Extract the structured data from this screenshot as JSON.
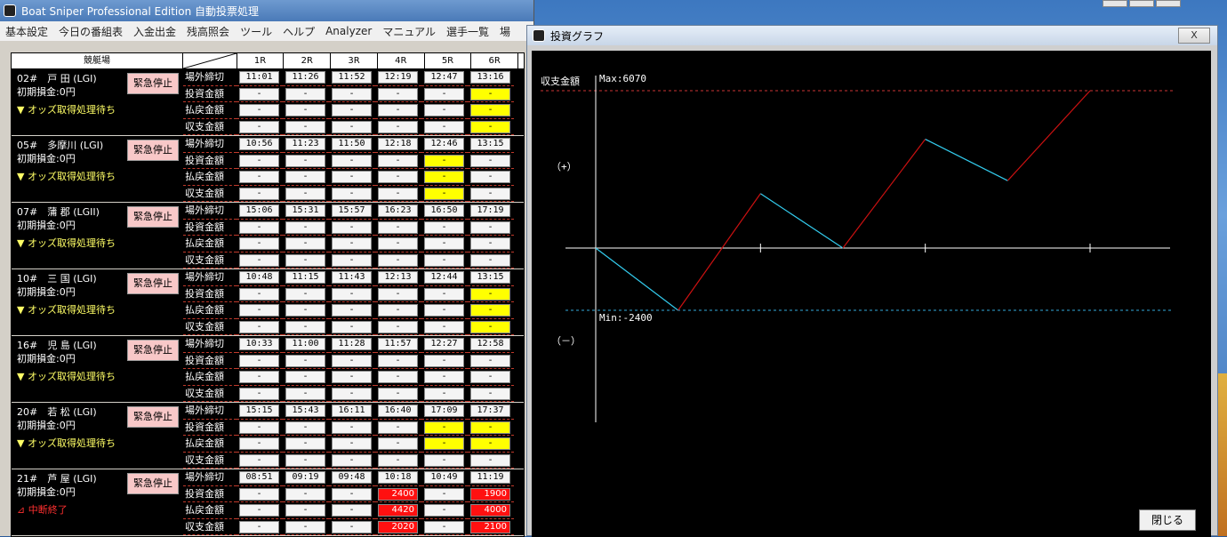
{
  "main_window": {
    "title": "Boat Sniper Professional Edition 自動投票処理"
  },
  "menu": [
    "基本設定",
    "今日の番組表",
    "入金出金",
    "残高照会",
    "ツール",
    "ヘルプ",
    "Analyzer",
    "マニュアル",
    "選手一覧",
    "場"
  ],
  "grid": {
    "header_venue": "競艇場",
    "races": [
      "1R",
      "2R",
      "3R",
      "4R",
      "5R",
      "6R"
    ],
    "row_labels": [
      "場外締切",
      "投資金額",
      "払戻金額",
      "収支金額"
    ],
    "stop_label": "緊急停止",
    "venues": [
      {
        "name": "02#　戸 田 (LGI)",
        "fund": "初期損金:0円",
        "status": "▼ オッズ取得処理待ち",
        "status_color": "yellow",
        "times": [
          "11:01",
          "11:26",
          "11:52",
          "12:19",
          "12:47",
          "13:16"
        ],
        "invest": [
          "-",
          "-",
          "-",
          "-",
          "-",
          "-"
        ],
        "refund": [
          "-",
          "-",
          "-",
          "-",
          "-",
          "-"
        ],
        "balance": [
          "-",
          "-",
          "-",
          "-",
          "-",
          "-"
        ],
        "invest_hl": [
          "",
          "",
          "",
          "",
          "",
          "y"
        ],
        "refund_hl": [
          "",
          "",
          "",
          "",
          "",
          "y"
        ],
        "balance_hl": [
          "",
          "",
          "",
          "",
          "",
          "y"
        ]
      },
      {
        "name": "05#　多摩川 (LGI)",
        "fund": "初期損金:0円",
        "status": "▼ オッズ取得処理待ち",
        "status_color": "yellow",
        "times": [
          "10:56",
          "11:23",
          "11:50",
          "12:18",
          "12:46",
          "13:15"
        ],
        "invest": [
          "-",
          "-",
          "-",
          "-",
          "-",
          "-"
        ],
        "refund": [
          "-",
          "-",
          "-",
          "-",
          "-",
          "-"
        ],
        "balance": [
          "-",
          "-",
          "-",
          "-",
          "-",
          "-"
        ],
        "invest_hl": [
          "",
          "",
          "",
          "",
          "y",
          ""
        ],
        "refund_hl": [
          "",
          "",
          "",
          "",
          "y",
          ""
        ],
        "balance_hl": [
          "",
          "",
          "",
          "",
          "y",
          ""
        ]
      },
      {
        "name": "07#　蒲 郡 (LGII)",
        "fund": "初期損金:0円",
        "status": "▼ オッズ取得処理待ち",
        "status_color": "yellow",
        "times": [
          "15:06",
          "15:31",
          "15:57",
          "16:23",
          "16:50",
          "17:19"
        ],
        "invest": [
          "-",
          "-",
          "-",
          "-",
          "-",
          "-"
        ],
        "refund": [
          "-",
          "-",
          "-",
          "-",
          "-",
          "-"
        ],
        "balance": [
          "-",
          "-",
          "-",
          "-",
          "-",
          "-"
        ],
        "invest_hl": [
          "",
          "",
          "",
          "",
          "",
          ""
        ],
        "refund_hl": [
          "",
          "",
          "",
          "",
          "",
          ""
        ],
        "balance_hl": [
          "",
          "",
          "",
          "",
          "",
          ""
        ]
      },
      {
        "name": "10#　三 国 (LGI)",
        "fund": "初期損金:0円",
        "status": "▼ オッズ取得処理待ち",
        "status_color": "yellow",
        "times": [
          "10:48",
          "11:15",
          "11:43",
          "12:13",
          "12:44",
          "13:15"
        ],
        "invest": [
          "-",
          "-",
          "-",
          "-",
          "-",
          "-"
        ],
        "refund": [
          "-",
          "-",
          "-",
          "-",
          "-",
          "-"
        ],
        "balance": [
          "-",
          "-",
          "-",
          "-",
          "-",
          "-"
        ],
        "invest_hl": [
          "",
          "",
          "",
          "",
          "",
          "y"
        ],
        "refund_hl": [
          "",
          "",
          "",
          "",
          "",
          "y"
        ],
        "balance_hl": [
          "",
          "",
          "",
          "",
          "",
          "y"
        ]
      },
      {
        "name": "16#　児 島 (LGI)",
        "fund": "初期損金:0円",
        "status": "▼ オッズ取得処理待ち",
        "status_color": "yellow",
        "times": [
          "10:33",
          "11:00",
          "11:28",
          "11:57",
          "12:27",
          "12:58"
        ],
        "invest": [
          "-",
          "-",
          "-",
          "-",
          "-",
          "-"
        ],
        "refund": [
          "-",
          "-",
          "-",
          "-",
          "-",
          "-"
        ],
        "balance": [
          "-",
          "-",
          "-",
          "-",
          "-",
          "-"
        ],
        "invest_hl": [
          "",
          "",
          "",
          "",
          "",
          ""
        ],
        "refund_hl": [
          "",
          "",
          "",
          "",
          "",
          ""
        ],
        "balance_hl": [
          "",
          "",
          "",
          "",
          "",
          ""
        ]
      },
      {
        "name": "20#　若 松 (LGI)",
        "fund": "初期損金:0円",
        "status": "▼ オッズ取得処理待ち",
        "status_color": "yellow",
        "times": [
          "15:15",
          "15:43",
          "16:11",
          "16:40",
          "17:09",
          "17:37"
        ],
        "invest": [
          "-",
          "-",
          "-",
          "-",
          "-",
          "-"
        ],
        "refund": [
          "-",
          "-",
          "-",
          "-",
          "-",
          "-"
        ],
        "balance": [
          "-",
          "-",
          "-",
          "-",
          "-",
          "-"
        ],
        "invest_hl": [
          "",
          "",
          "",
          "",
          "y",
          "y"
        ],
        "refund_hl": [
          "",
          "",
          "",
          "",
          "y",
          "y"
        ],
        "balance_hl": [
          "",
          "",
          "",
          "",
          "",
          ""
        ]
      },
      {
        "name": "21#　芦 屋 (LGI)",
        "fund": "初期損金:0円",
        "status": "⊿ 中断終了",
        "status_color": "red",
        "times": [
          "08:51",
          "09:19",
          "09:48",
          "10:18",
          "10:49",
          "11:19"
        ],
        "invest": [
          "-",
          "-",
          "-",
          "2400",
          "-",
          "1900"
        ],
        "refund": [
          "-",
          "-",
          "-",
          "4420",
          "-",
          "4000"
        ],
        "balance": [
          "-",
          "-",
          "-",
          "2020",
          "-",
          "2100"
        ],
        "invest_hl": [
          "",
          "",
          "",
          "r",
          "",
          "r"
        ],
        "refund_hl": [
          "",
          "",
          "",
          "r",
          "",
          "r"
        ],
        "balance_hl": [
          "",
          "",
          "",
          "r",
          "",
          "r"
        ]
      }
    ]
  },
  "graph_window": {
    "title": "投資グラフ",
    "close_x": "X",
    "close_button": "閉じる",
    "colors": {
      "gain": "#cc1111",
      "loss": "#33ccee",
      "axis": "#ffffff",
      "max_line": "#cc3333",
      "min_line": "#33aadd"
    },
    "labels": {
      "ylabel": "収支金額",
      "plus": "（+）",
      "minus": "（－）",
      "max_label": "Max:6070",
      "min_label": "Min:-2400"
    }
  },
  "chart_data": {
    "type": "line",
    "title": "",
    "ylabel": "収支金額",
    "max": 6070,
    "min": -2400,
    "y": [
      0,
      -2400,
      2100,
      0,
      4200,
      2600,
      6070
    ],
    "x_ticks": 3
  }
}
